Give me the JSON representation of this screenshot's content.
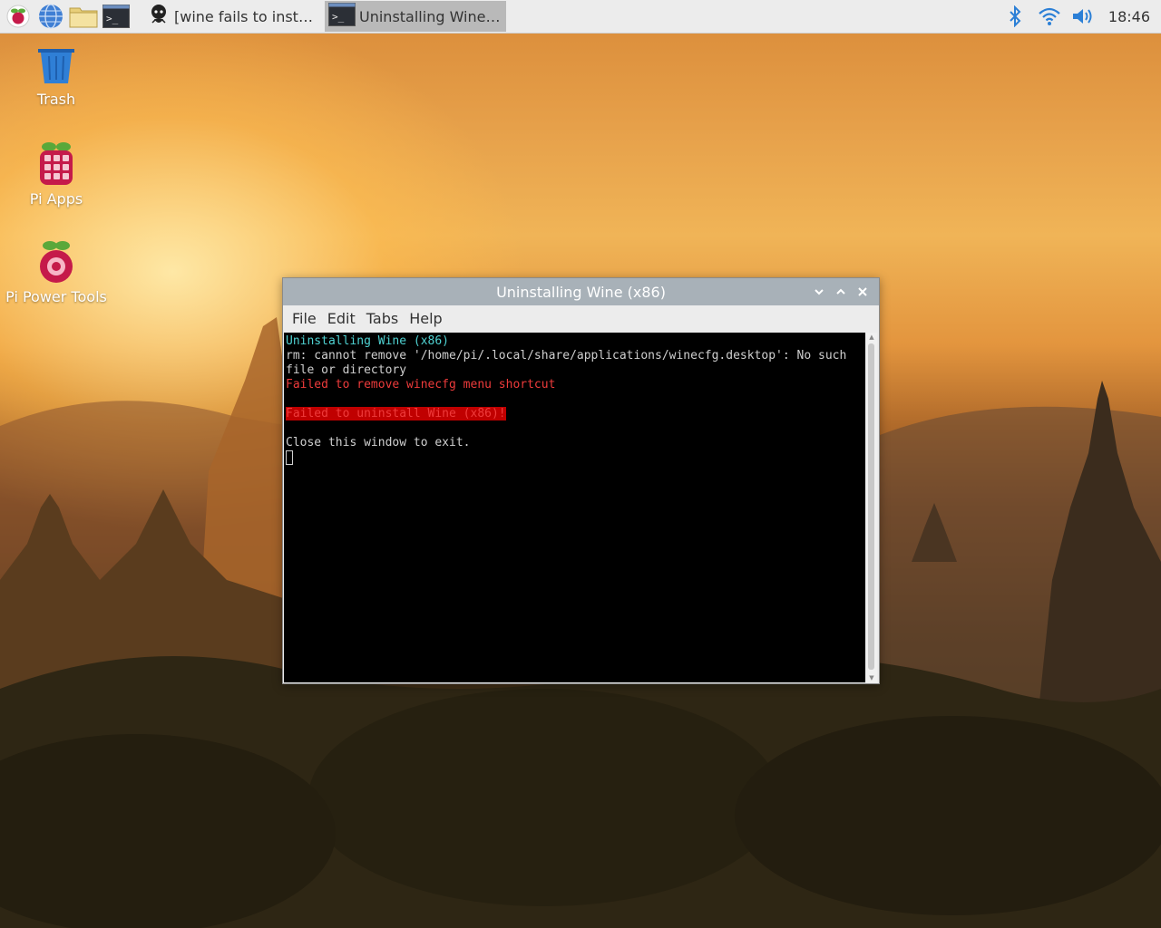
{
  "taskbar": {
    "launchers": [
      "raspberry-menu-icon",
      "web-browser-icon",
      "file-manager-icon",
      "terminal-icon"
    ],
    "tasks": [
      {
        "label": "[wine fails to install · I...",
        "icon": "github-icon",
        "active": false
      },
      {
        "label": "Uninstalling Wine (x8...",
        "icon": "terminal-icon",
        "active": true
      }
    ],
    "tray": {
      "clock": "18:46"
    }
  },
  "desktop": {
    "icons": [
      {
        "label": "Trash",
        "icon": "trash-icon"
      },
      {
        "label": "Pi Apps",
        "icon": "pi-apps-icon"
      },
      {
        "label": "Pi Power Tools",
        "icon": "pi-power-tools-icon"
      }
    ]
  },
  "window": {
    "title": "Uninstalling Wine (x86)",
    "menu": [
      "File",
      "Edit",
      "Tabs",
      "Help"
    ],
    "terminal": {
      "line1": "Uninstalling Wine (x86)",
      "line2": "rm: cannot remove '/home/pi/.local/share/applications/winecfg.desktop': No such",
      "line3": "file or directory",
      "line4": "Failed to remove winecfg menu shortcut",
      "line5": "Failed to uninstall Wine (x86)!",
      "line6": "Close this window to exit."
    }
  }
}
